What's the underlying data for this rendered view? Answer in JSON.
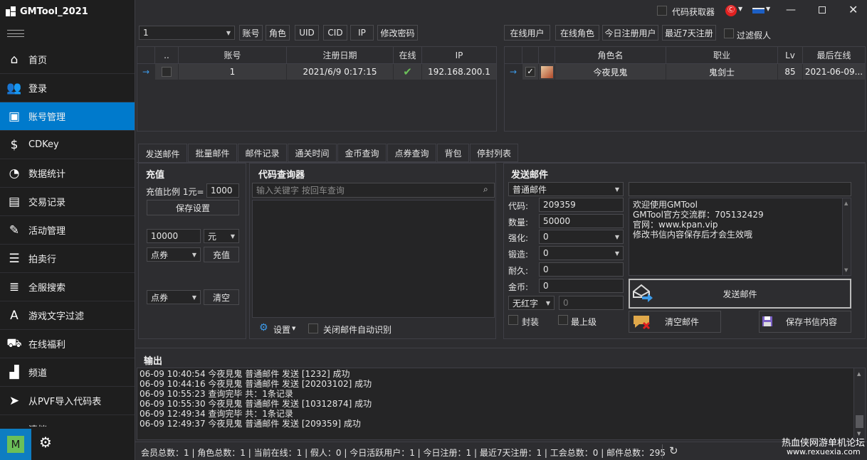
{
  "app": {
    "title": "GMTool_2021",
    "m_badge": "M"
  },
  "sidebar": {
    "items": [
      {
        "label": "首页",
        "icon": "home-icon",
        "glyph": "⌂"
      },
      {
        "label": "登录",
        "icon": "users-icon",
        "glyph": "👥"
      },
      {
        "label": "账号管理",
        "icon": "id-card-icon",
        "glyph": "▣"
      },
      {
        "label": "CDKey",
        "icon": "dollar-icon",
        "glyph": "$"
      },
      {
        "label": "数据统计",
        "icon": "dashboard-icon",
        "glyph": "◔"
      },
      {
        "label": "交易记录",
        "icon": "log-icon",
        "glyph": "▤"
      },
      {
        "label": "活动管理",
        "icon": "ticket-icon",
        "glyph": "✎"
      },
      {
        "label": "拍卖行",
        "icon": "database-icon",
        "glyph": "☰"
      },
      {
        "label": "全服搜索",
        "icon": "list-icon",
        "glyph": "≣"
      },
      {
        "label": "游戏文字过滤",
        "icon": "text-filter-icon",
        "glyph": "A"
      },
      {
        "label": "在线福利",
        "icon": "truck-icon",
        "glyph": "⛟"
      },
      {
        "label": "频道",
        "icon": "factory-icon",
        "glyph": "▟"
      },
      {
        "label": "从PVF导入代码表",
        "icon": "cursor-icon",
        "glyph": "➤"
      },
      {
        "label": "清档",
        "icon": "cloud-icon",
        "glyph": "☁"
      }
    ]
  },
  "titlebar": {
    "code_fetcher": "代码获取器"
  },
  "toolbar": {
    "account_combo": "1",
    "buttons": [
      "账号",
      "角色",
      "UID",
      "CID",
      "IP",
      "修改密码"
    ],
    "right_buttons": [
      "在线用户",
      "在线角色",
      "今日注册用户",
      "最近7天注册"
    ],
    "filter_fake": "过滤假人"
  },
  "account_grid": {
    "headers": [
      "..",
      "账号",
      "注册日期",
      "在线",
      "IP"
    ],
    "rows": [
      {
        "account": "1",
        "reg_date": "2021/6/9 0:17:15",
        "ip": "192.168.200.1"
      }
    ]
  },
  "role_grid": {
    "headers": [
      "角色名",
      "职业",
      "Lv",
      "最后在线"
    ],
    "rows": [
      {
        "name": "今夜見鬼",
        "job": "鬼剑士",
        "lv": "85",
        "last": "2021-06-09..."
      }
    ]
  },
  "tabs": [
    "发送邮件",
    "批量邮件",
    "邮件记录",
    "通关时间",
    "金币查询",
    "点券查询",
    "背包",
    "停封列表"
  ],
  "recharge": {
    "title": "充值",
    "ratio_label": "充值比例 1元=",
    "ratio_value": "1000",
    "save_btn": "保存设置",
    "amount": "10000",
    "unit": "元",
    "type1": "点券",
    "charge_btn": "充值",
    "type2": "点券",
    "clear_btn": "清空"
  },
  "code_query": {
    "title": "代码查询器",
    "placeholder": "输入关键字 按回车查询",
    "settings": "设置",
    "auto_detect": "关闭邮件自动识别"
  },
  "mail": {
    "title": "发送邮件",
    "type": "普通邮件",
    "code_label": "代码:",
    "code": "209359",
    "qty_label": "数量:",
    "qty": "50000",
    "enhance_label": "强化:",
    "enhance": "0",
    "forge_label": "锻造:",
    "forge": "0",
    "dur_label": "耐久:",
    "dur": "0",
    "gold_label": "金币:",
    "gold": "0",
    "red": "无红字",
    "red_val": "0",
    "seal": "封装",
    "max_level": "最上级",
    "content": [
      "欢迎使用GMTool",
      "GMTool官方交流群：705132429",
      "官网：www.kpan.vip",
      "修改书信内容保存后才会生效哦"
    ],
    "send_btn": "发送邮件",
    "clear_btn": "清空邮件",
    "save_btn": "保存书信内容"
  },
  "output": {
    "title": "输出",
    "lines": [
      "06-09 10:40:54 今夜見鬼 普通邮件 发送 [1232] 成功",
      "06-09 10:44:16 今夜見鬼 普通邮件 发送 [20203102] 成功",
      "06-09 10:55:23 查询完毕 共：1条记录",
      "06-09 10:55:30 今夜見鬼 普通邮件 发送 [10312874] 成功",
      "06-09 12:49:34 查询完毕 共：1条记录",
      "06-09 12:49:37 今夜見鬼 普通邮件 发送 [209359] 成功"
    ]
  },
  "status": {
    "text": "会员总数：1 | 角色总数：1 | 当前在线：1 | 假人：0 | 今日活跃用户：1 | 今日注册：1 | 最近7天注册：1 | 工会总数：0 | 邮件总数：295"
  },
  "watermark": {
    "line1": "热血侠网游单机论坛",
    "line2": "www.rexuexia.com"
  },
  "colors": {
    "accent": "#007acc",
    "online": "#6bbf59",
    "badge": "#6bbf59"
  }
}
